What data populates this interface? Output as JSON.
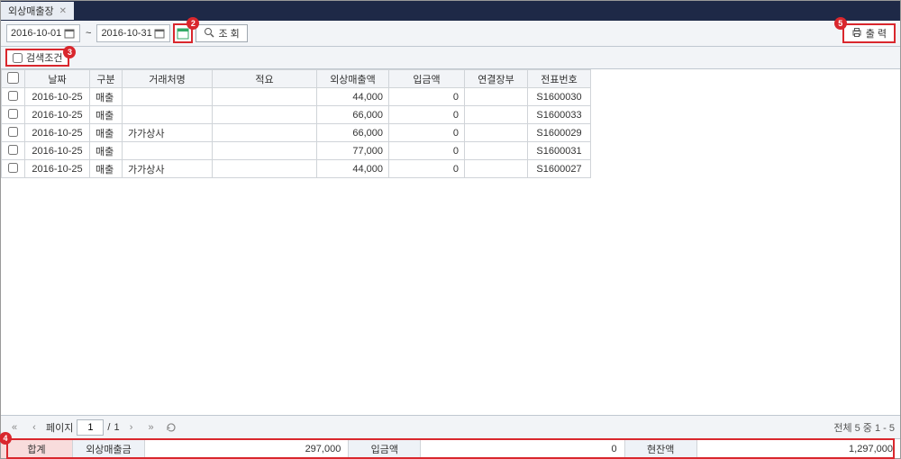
{
  "tab": {
    "title": "외상매출장"
  },
  "toolbar": {
    "date_from": "2016-10-01",
    "date_to": "2016-10-31",
    "tilde": "~",
    "query_label": "조 회",
    "print_label": "출 력"
  },
  "filter": {
    "label": "검색조건"
  },
  "callouts": {
    "c2": "2",
    "c3": "3",
    "c4": "4",
    "c5": "5"
  },
  "table": {
    "headers": {
      "date": "날짜",
      "type": "구분",
      "client": "거래처명",
      "summary": "적요",
      "amount": "외상매출액",
      "deposit": "입금액",
      "link": "연결장부",
      "voucher": "전표번호"
    },
    "rows": [
      {
        "date": "2016-10-25",
        "type": "매출",
        "client": "",
        "summary": "",
        "amount": "44,000",
        "deposit": "0",
        "link": "",
        "voucher": "S1600030"
      },
      {
        "date": "2016-10-25",
        "type": "매출",
        "client": "",
        "summary": "",
        "amount": "66,000",
        "deposit": "0",
        "link": "",
        "voucher": "S1600033"
      },
      {
        "date": "2016-10-25",
        "type": "매출",
        "client": "가가상사",
        "summary": "",
        "amount": "66,000",
        "deposit": "0",
        "link": "",
        "voucher": "S1600029"
      },
      {
        "date": "2016-10-25",
        "type": "매출",
        "client": "",
        "summary": "",
        "amount": "77,000",
        "deposit": "0",
        "link": "",
        "voucher": "S1600031"
      },
      {
        "date": "2016-10-25",
        "type": "매출",
        "client": "가가상사",
        "summary": "",
        "amount": "44,000",
        "deposit": "0",
        "link": "",
        "voucher": "S1600027"
      }
    ]
  },
  "pagination": {
    "label": "페이지",
    "current": "1",
    "sep": "/",
    "total": "1",
    "info": "전체 5 중 1 - 5"
  },
  "summary": {
    "total_label": "합계",
    "amount_label": "외상매출금",
    "amount_value": "297,000",
    "deposit_label": "입금액",
    "deposit_value": "0",
    "balance_label": "현잔액",
    "balance_value": "1,297,000"
  }
}
